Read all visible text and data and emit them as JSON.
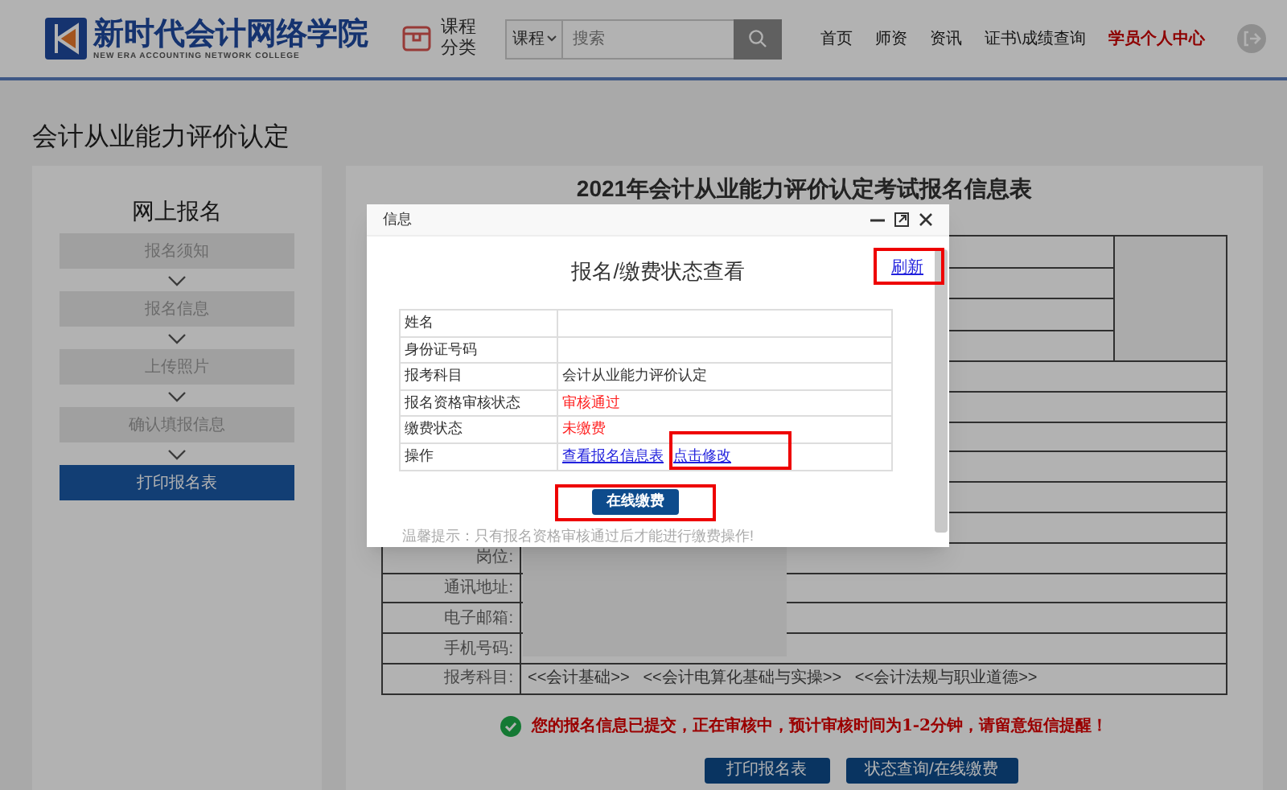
{
  "header": {
    "logo_name": "新时代会计网络学院",
    "logo_subtitle": "NEW ERA ACCOUNTING NETWORK COLLEGE",
    "category_lines": [
      "课程",
      "分类"
    ],
    "search": {
      "scope": "课程",
      "placeholder": "搜索"
    },
    "nav": [
      {
        "label": "首页",
        "selected": false
      },
      {
        "label": "师资",
        "selected": false
      },
      {
        "label": "资讯",
        "selected": false
      },
      {
        "label": "证书\\成绩查询",
        "selected": false
      },
      {
        "label": "学员个人中心",
        "selected": true
      }
    ]
  },
  "page_title": "会计从业能力评价认定",
  "sidebar": {
    "title": "网上报名",
    "steps": [
      {
        "label": "报名须知",
        "selected": false
      },
      {
        "label": "报名信息",
        "selected": false
      },
      {
        "label": "上传照片",
        "selected": false
      },
      {
        "label": "确认填报信息",
        "selected": false
      },
      {
        "label": "打印报名表",
        "selected": true
      }
    ]
  },
  "form": {
    "title": "2021年会计从业能力评价认定考试报名信息表",
    "rows": [
      {
        "label": "岗位:"
      },
      {
        "label": "通讯地址:"
      },
      {
        "label": "电子邮箱:"
      },
      {
        "label": "手机号码:"
      },
      {
        "label": "报考科目:",
        "value": "<<会计基础>>   <<会计电算化基础与实操>>   <<会计法规与职业道德>>"
      }
    ]
  },
  "status_message": "您的报名信息已提交，正在审核中，预计审核时间为1-2分钟，请留意短信提醒！",
  "buttons": [
    "打印报名表",
    "状态查询/在线缴费"
  ],
  "modal": {
    "title": "信息",
    "heading": "报名/缴费状态查看",
    "refresh_link": "刷新",
    "rows": [
      {
        "label": "姓名",
        "kind": "text"
      },
      {
        "label": "身份证号码",
        "kind": "text"
      },
      {
        "label": "报考科目",
        "kind": "text",
        "value": "会计从业能力评价认定"
      },
      {
        "label": "报名资格审核状态",
        "kind": "status",
        "value": "审核通过"
      },
      {
        "label": "缴费状态",
        "kind": "status",
        "value": "未缴费"
      },
      {
        "label": "操作",
        "kind": "links",
        "links": [
          "查看报名信息表",
          "点击修改"
        ]
      }
    ],
    "pay_button": "在线缴费",
    "tip": "温馨提示：只有报名资格审核通过后才能进行缴费操作!"
  }
}
